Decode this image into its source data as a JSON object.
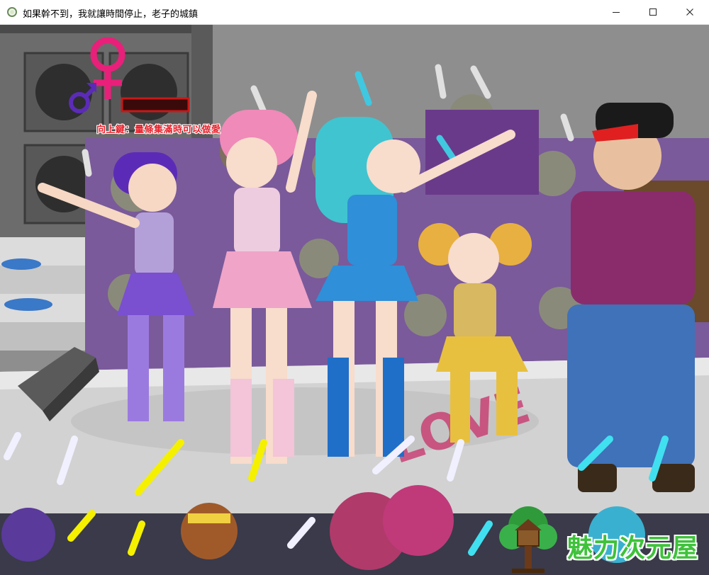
{
  "window": {
    "title": "如果幹不到，我就讓時間停止，老子的城鎮"
  },
  "hud": {
    "female_symbol": "♀",
    "male_symbol": "♂",
    "gauge_fill": 0.0,
    "instruction": "向上鍵：量條集滿時可以做愛"
  },
  "stage": {
    "banner_text": "LOVE"
  },
  "watermark": {
    "text": "魅力次元屋"
  },
  "colors": {
    "female_symbol": "#e8207a",
    "male_symbol": "#5b2bb8",
    "gauge_border": "#c81818",
    "gauge_bg": "#3a0a0a",
    "instruction_text": "#e8202a",
    "watermark_text": "#3ec23a",
    "idol_purple": "#7a4fd0",
    "idol_pink": "#f0a4c8",
    "idol_blue": "#2f8fd8",
    "idol_yellow": "#e8c040",
    "manager_jacket": "#8a2c6c",
    "manager_jeans": "#3f72b8",
    "glowstick_yellow": "#f4f000",
    "glowstick_white": "#f0f0ff",
    "glowstick_cyan": "#40e0f0"
  }
}
